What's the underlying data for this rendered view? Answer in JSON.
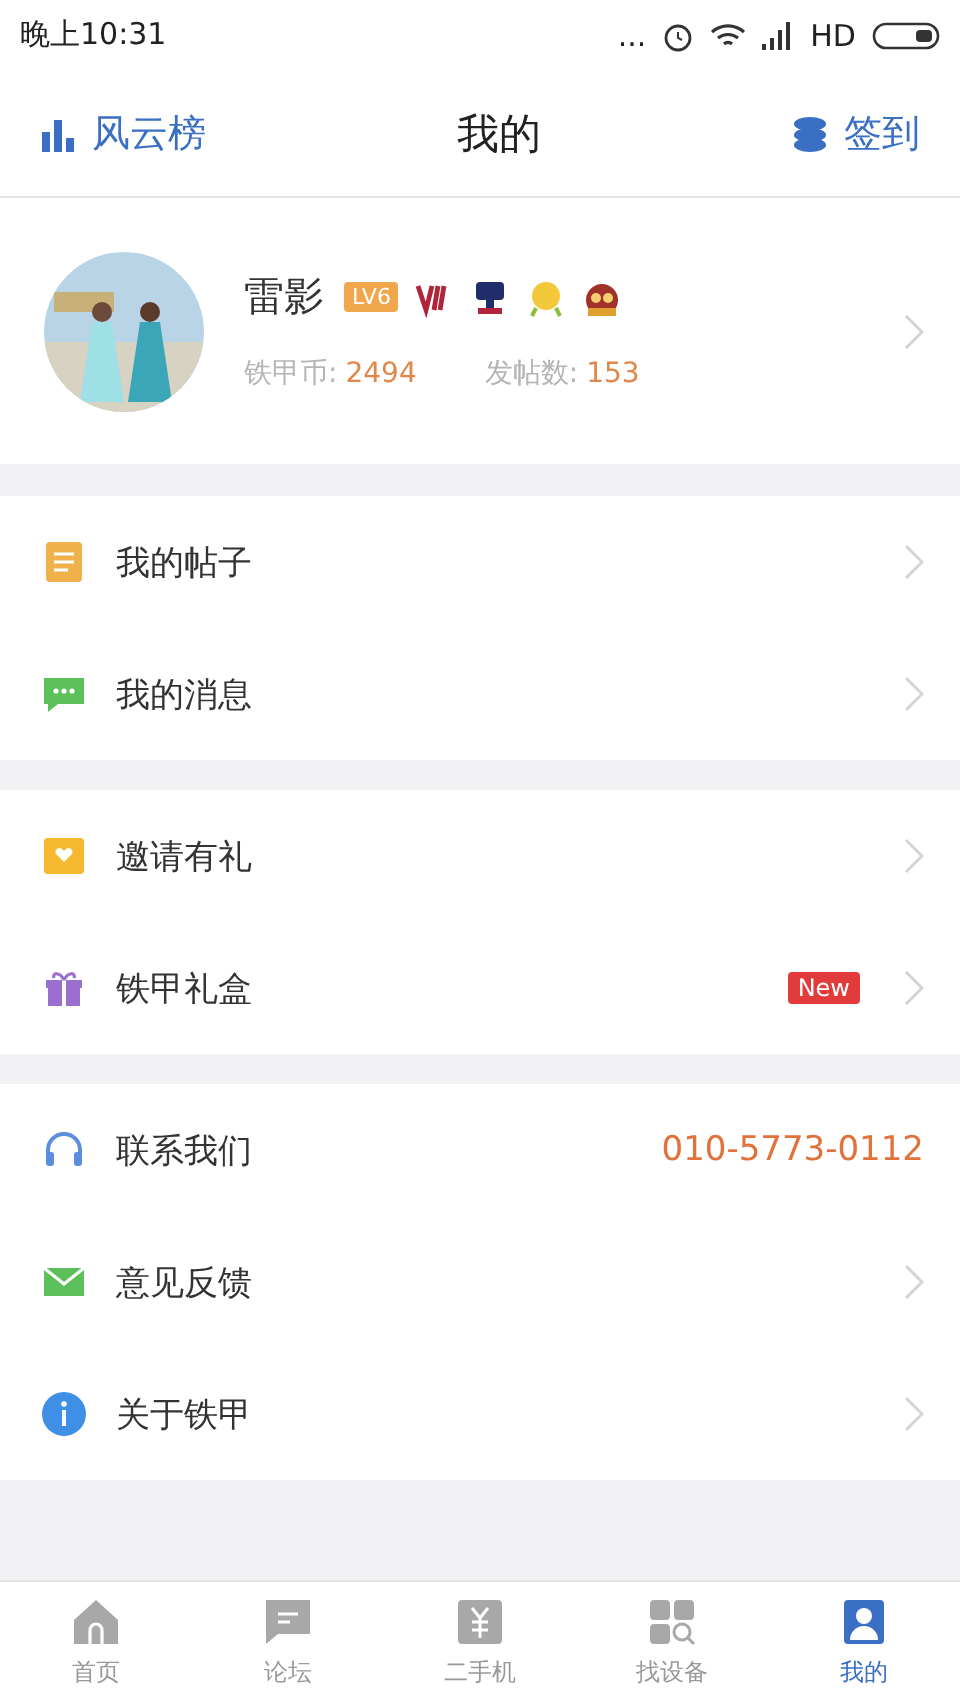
{
  "status_bar": {
    "time": "晚上10:31",
    "dots": "...",
    "network": "HD"
  },
  "header": {
    "left": "风云榜",
    "title": "我的",
    "right": "签到"
  },
  "profile": {
    "name": "雷影",
    "level": "LV6",
    "coins_label": "铁甲币:",
    "coins": "2494",
    "posts_label": "发帖数:",
    "posts": "153"
  },
  "groups": [
    {
      "items": [
        {
          "kind": "posts",
          "label": "我的帖子"
        },
        {
          "kind": "messages",
          "label": "我的消息"
        }
      ]
    },
    {
      "items": [
        {
          "kind": "invite",
          "label": "邀请有礼"
        },
        {
          "kind": "gift",
          "label": "铁甲礼盒",
          "badge": "New"
        }
      ]
    },
    {
      "items": [
        {
          "kind": "contact",
          "label": "联系我们",
          "value": "010-5773-0112"
        },
        {
          "kind": "feedback",
          "label": "意见反馈"
        },
        {
          "kind": "about",
          "label": "关于铁甲"
        }
      ]
    }
  ],
  "tabs": [
    {
      "kind": "home",
      "label": "首页",
      "selected": false
    },
    {
      "kind": "forum",
      "label": "论坛",
      "selected": false
    },
    {
      "kind": "used",
      "label": "二手机",
      "selected": false
    },
    {
      "kind": "find",
      "label": "找设备",
      "selected": false
    },
    {
      "kind": "me",
      "label": "我的",
      "selected": true
    }
  ]
}
